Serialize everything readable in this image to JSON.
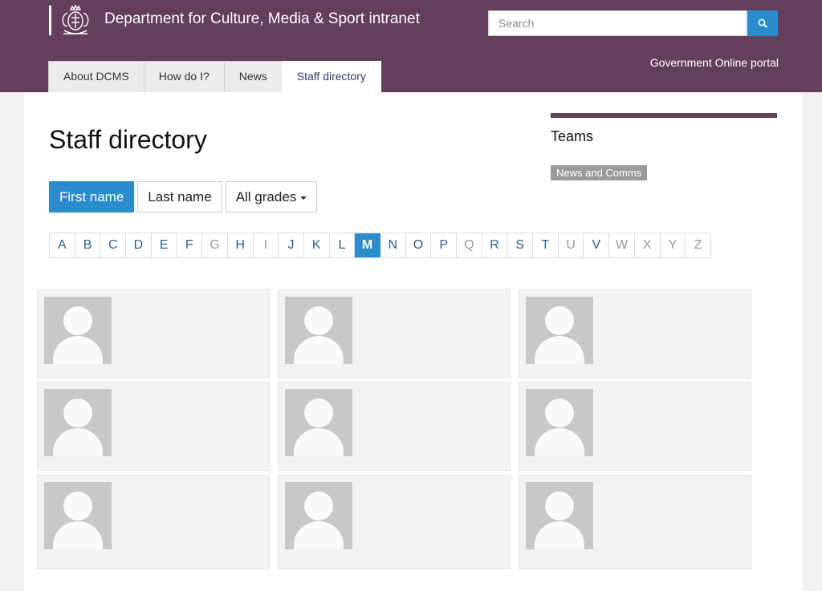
{
  "header": {
    "site_title": "Department for Culture, Media & Sport intranet",
    "search": {
      "placeholder": "Search"
    },
    "portal_link": "Government Online portal",
    "tabs": [
      {
        "label": "About DCMS",
        "active": false
      },
      {
        "label": "How do I?",
        "active": false
      },
      {
        "label": "News",
        "active": false
      },
      {
        "label": "Staff directory",
        "active": true
      }
    ]
  },
  "main": {
    "title": "Staff directory",
    "filters": {
      "first_name": "First name",
      "last_name": "Last name",
      "all_grades": "All grades"
    },
    "alphabet": [
      "A",
      "B",
      "C",
      "D",
      "E",
      "F",
      "G",
      "H",
      "I",
      "J",
      "K",
      "L",
      "M",
      "N",
      "O",
      "P",
      "Q",
      "R",
      "S",
      "T",
      "U",
      "V",
      "W",
      "X",
      "Y",
      "Z"
    ],
    "alphabet_dimmed": [
      "G",
      "I",
      "Q",
      "U",
      "W",
      "X",
      "Y",
      "Z"
    ],
    "alphabet_selected": "M"
  },
  "sidebar": {
    "heading": "Teams",
    "tags": [
      "News and Comms"
    ]
  },
  "icons": {
    "crest": "royal-crest-icon",
    "search": "search-icon",
    "avatar": "person-placeholder-icon",
    "dropdown": "caret-down-icon"
  },
  "colors": {
    "brand": "#633f5c",
    "accent": "#2b8ccd"
  }
}
